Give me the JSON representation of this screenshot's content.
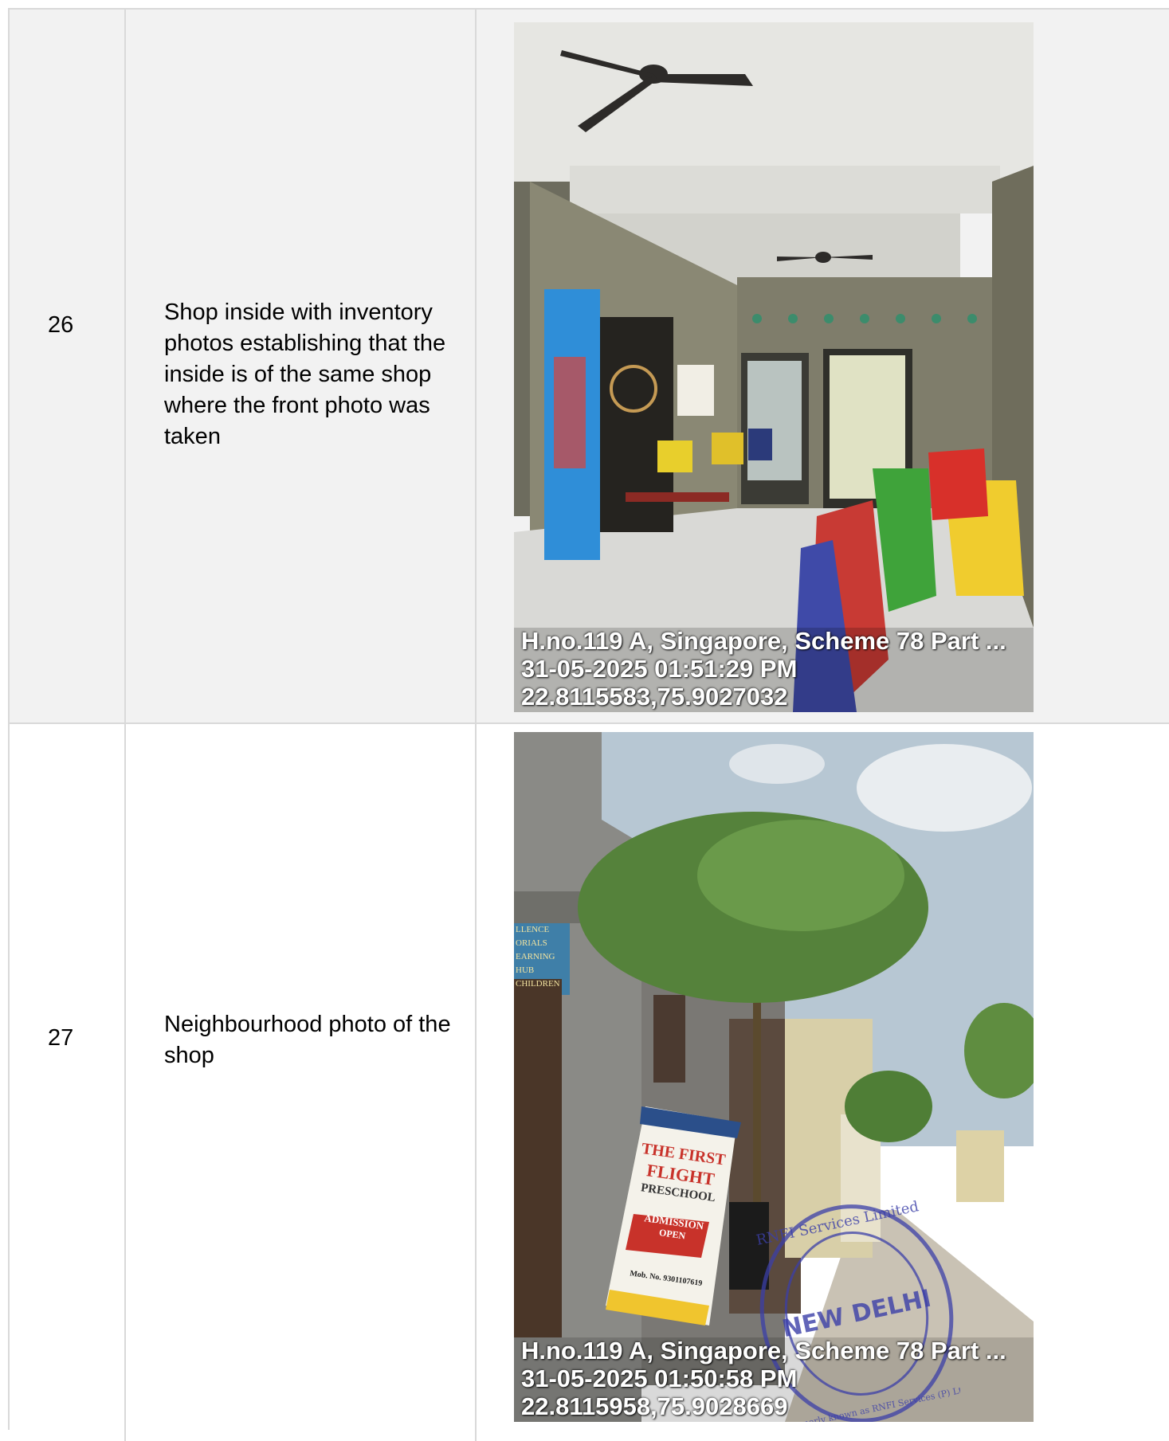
{
  "rows": [
    {
      "number": "26",
      "description": "Shop inside with inventory photos establishing that the inside is of the same shop where the front photo was taken",
      "photo": {
        "address": "H.no.119 A, Singapore, Scheme 78 Part ...",
        "timestamp": "31-05-2025 01:51:29 PM",
        "coordinates": "22.8115583,75.9027032"
      }
    },
    {
      "number": "27",
      "description": "Neighbourhood photo of the shop",
      "photo": {
        "address": "H.no.119 A, Singapore, Scheme 78 Part ...",
        "timestamp": "31-05-2025 01:50:58 PM",
        "coordinates": "22.8115958,75.9028669",
        "signboard": {
          "line1": "THE FIRST",
          "line2": "FLIGHT",
          "line3": "PRESCHOOL",
          "admission": "ADMISSION",
          "open": "OPEN",
          "mobile": "Mob. No. 9301107619"
        },
        "side_sign": [
          "LLENCE",
          "ORIALS",
          "EARNING HUB",
          "CHILDREN"
        ],
        "stamp": {
          "top_text": "RNFI Services Limited",
          "center_text": "NEW DELHI",
          "bottom_text": "Formerly known as RNFI Services (P) Ltd"
        }
      }
    }
  ],
  "colors": {
    "grid": "#d9d9d9",
    "row_shade": "#f2f2f2",
    "stamp": "#3b3fa8"
  }
}
